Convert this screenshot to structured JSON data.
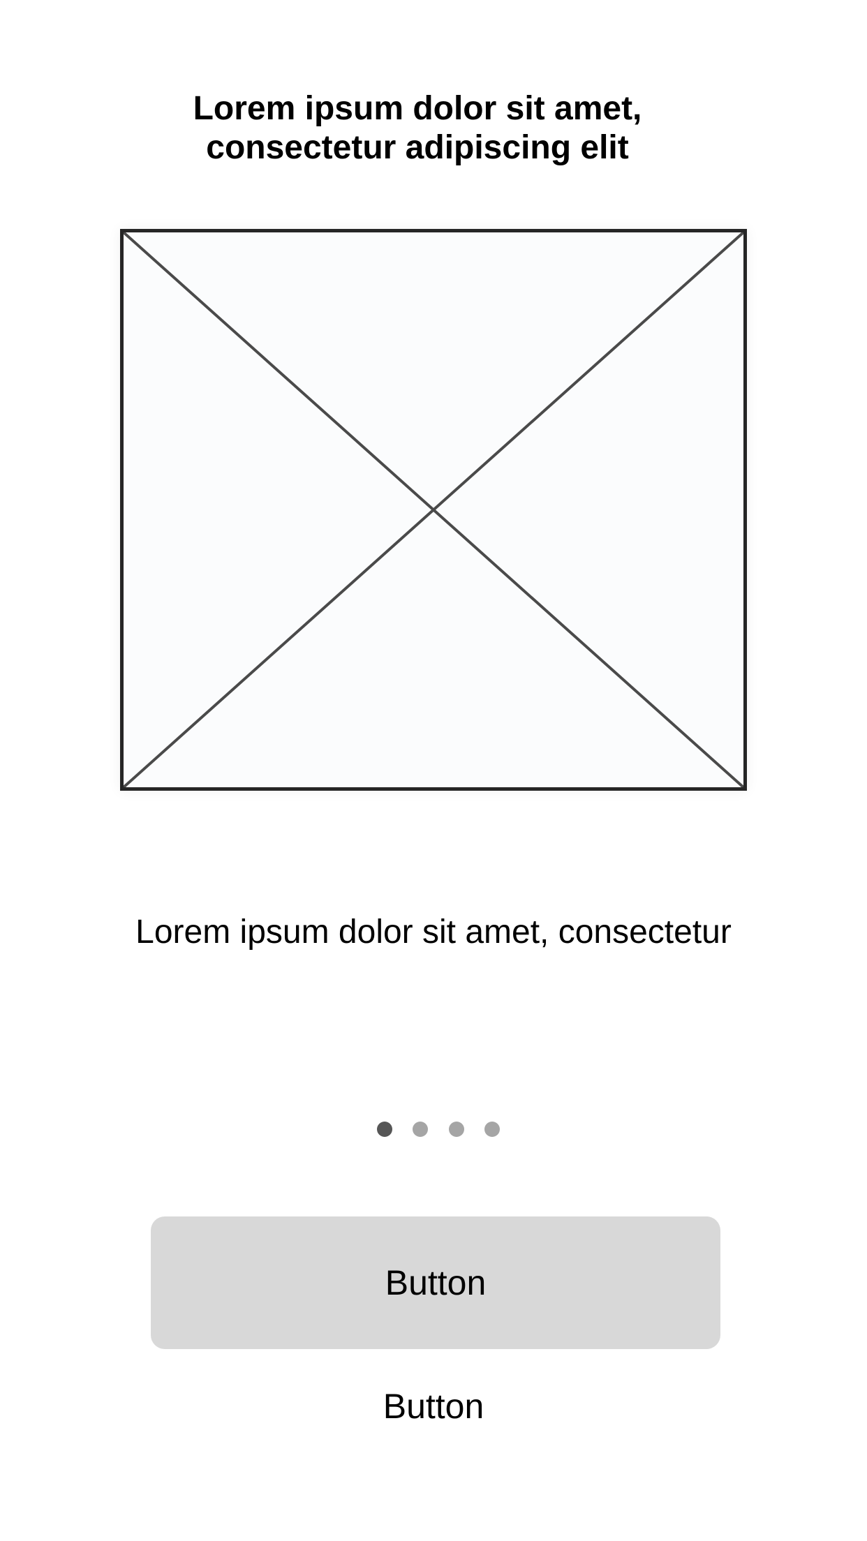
{
  "header": {
    "title_line1": "Lorem ipsum dolor sit amet,",
    "title_line2": "consectetur adipiscing elit"
  },
  "main": {
    "image_icon": "image-placeholder-icon",
    "description": "Lorem ipsum dolor sit amet, consectetur"
  },
  "pager": {
    "page_count": 4,
    "active_page": 1
  },
  "actions": {
    "primary_label": "Button",
    "secondary_label": "Button"
  },
  "colors": {
    "background": "#ffffff",
    "button_bg": "#d8d8d8",
    "dot_active": "#565656",
    "dot_inactive": "#a5a5a5",
    "placeholder_border": "#262626"
  }
}
